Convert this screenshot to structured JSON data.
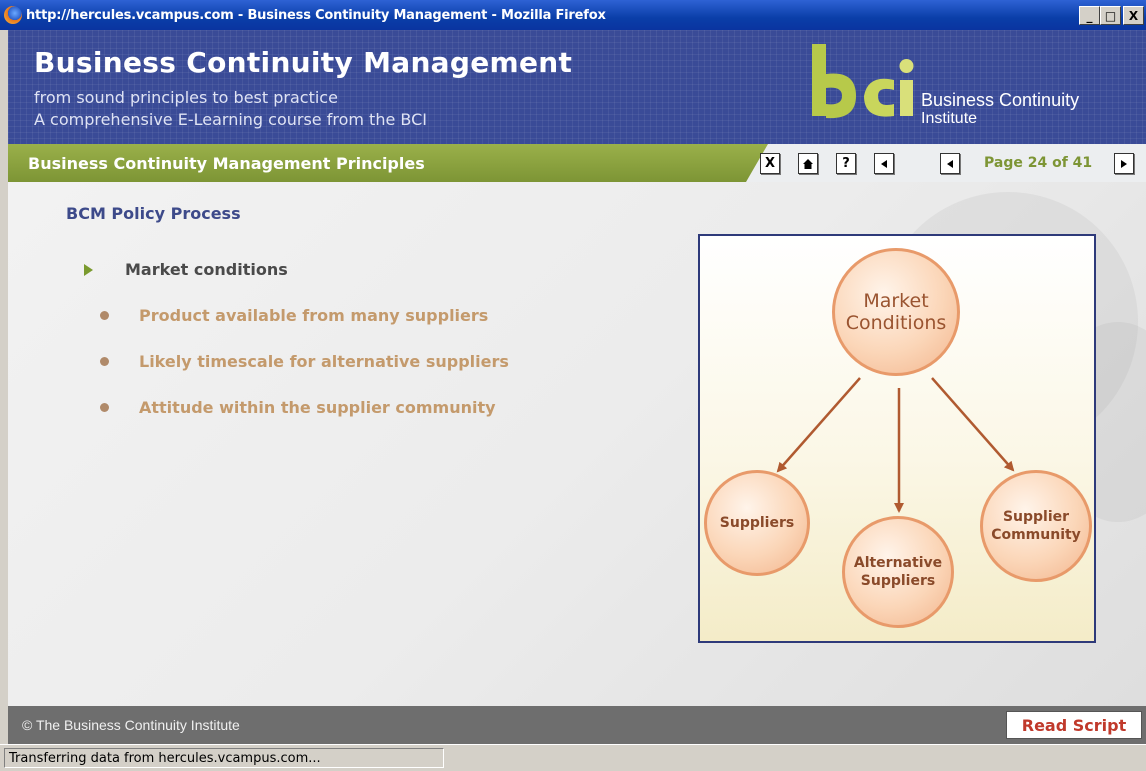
{
  "window": {
    "title": "http://hercules.vcampus.com - Business Continuity Management - Mozilla Firefox",
    "minimize": "_",
    "maximize": "□",
    "close": "X"
  },
  "banner": {
    "title": "Business Continuity Management",
    "subtitle1": "from sound principles to best practice",
    "subtitle2": "A comprehensive E-Learning course from the BCI",
    "logo_line1": "Business Continuity",
    "logo_line2": "Institute",
    "logo_colors": {
      "green": "#b7c94a",
      "light": "#d9e07a"
    }
  },
  "nav": {
    "section": "Business Continuity Management Principles",
    "buttons": [
      {
        "icon": "close-icon",
        "glyph": "X"
      },
      {
        "icon": "home-icon",
        "glyph": "⌂"
      },
      {
        "icon": "help-icon",
        "glyph": "?"
      },
      {
        "icon": "first-page-icon",
        "glyph": "◀"
      },
      {
        "icon": "prev-page-icon",
        "glyph": "◀"
      },
      {
        "icon": "next-page-icon",
        "glyph": "▶"
      }
    ],
    "page_info": "Page 24 of 41"
  },
  "content": {
    "heading": "BCM Policy Process",
    "main_bullet": "Market conditions",
    "sub_bullets": [
      "Product available from many suppliers",
      "Likely timescale for alternative suppliers",
      "Attitude within the supplier community"
    ]
  },
  "diagram": {
    "center": [
      "Market",
      "Conditions"
    ],
    "left": [
      "Suppliers"
    ],
    "middle": [
      "Alternative",
      "Suppliers"
    ],
    "right": [
      "Supplier",
      "Community"
    ]
  },
  "footer": {
    "copyright": "© The Business Continuity Institute",
    "read_script": "Read Script"
  },
  "status": {
    "text": "Transferring data from hercules.vcampus.com..."
  },
  "colors": {
    "banner": "#3a4b97",
    "nav_green": "#7d9535",
    "heading": "#3d4a8a",
    "sub_bullet": "#c49a6c",
    "read_script": "#c0392b"
  }
}
